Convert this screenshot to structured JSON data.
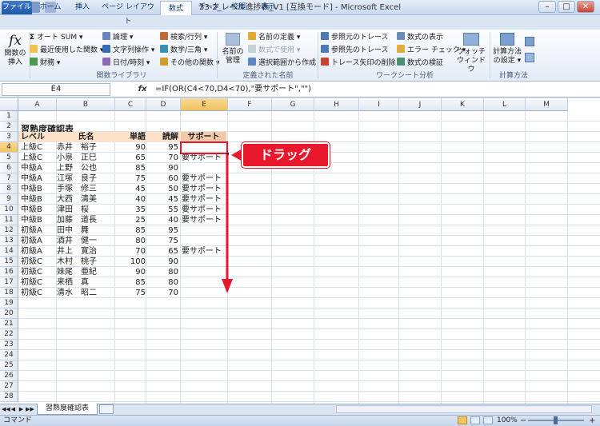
{
  "window": {
    "title": "33-2_レベル進捗表_V1  [互換モード]  -  Microsoft Excel",
    "minimize": "–",
    "maximize": "□",
    "close": "✕"
  },
  "tabs": [
    "ファイル",
    "ホーム",
    "挿入",
    "ページ レイアウト",
    "数式",
    "データ",
    "校閲",
    "表示"
  ],
  "active_tab": "数式",
  "ribbon": {
    "insert_function": [
      "関数の",
      "挿入"
    ],
    "library": {
      "autosum": "オート SUM ▾",
      "recent": "最近使用した関数 ▾",
      "financial": "財務 ▾",
      "logical": "論理 ▾",
      "text": "文字列操作 ▾",
      "datetime": "日付/時刻 ▾",
      "lookup": "検索/行列 ▾",
      "math": "数学/三角 ▾",
      "more": "その他の関数 ▾",
      "group_label": "関数ライブラリ"
    },
    "names": {
      "manager": [
        "名前の",
        "管理"
      ],
      "define": "名前の定義 ▾",
      "use": "数式で使用 ▾",
      "create": "選択範囲から作成",
      "group_label": "定義された名前"
    },
    "audit": {
      "precedents": "参照元のトレース",
      "dependents": "参照先のトレース",
      "remove_arrows": "トレース矢印の削除 ▾",
      "show_formulas": "数式の表示",
      "error_check": "エラー チェック ▾",
      "evaluate": "数式の検証",
      "group_label": "ワークシート分析"
    },
    "watch": [
      "ウォッチ",
      "ウィンドウ"
    ],
    "calc_options": [
      "計算方法",
      "の設定 ▾"
    ],
    "calc_group_label": "計算方法"
  },
  "formula_bar": {
    "name_box": "E4",
    "fx": "fx",
    "formula": "=IF(OR(C4<70,D4<70),\"要サポート\",\"\")"
  },
  "columns": [
    "A",
    "B",
    "C",
    "D",
    "E",
    "F",
    "G",
    "H",
    "I",
    "J",
    "K",
    "L",
    "M"
  ],
  "selected_column": "E",
  "row_numbers": [
    "1",
    "2",
    "3",
    "4",
    "5",
    "6",
    "7",
    "8",
    "9",
    "10",
    "11",
    "12",
    "13",
    "14",
    "15",
    "16",
    "17",
    "18",
    "19",
    "20",
    "21",
    "22",
    "23",
    "24",
    "25",
    "26",
    "27",
    "28"
  ],
  "selected_row": "4",
  "sheet": {
    "title": "習熟度確認表",
    "headers": [
      "レベル",
      "氏名",
      "単語",
      "読解",
      "サポート"
    ],
    "rows": [
      [
        "上級C",
        "赤井　裕子",
        "90",
        "95",
        ""
      ],
      [
        "上級C",
        "小泉　正巳",
        "65",
        "70",
        "要サポート"
      ],
      [
        "中級A",
        "上野　公也",
        "85",
        "90",
        ""
      ],
      [
        "中級A",
        "江塚　良子",
        "75",
        "60",
        "要サポート"
      ],
      [
        "中級B",
        "手塚　修三",
        "45",
        "50",
        "要サポート"
      ],
      [
        "中級B",
        "大西　清美",
        "40",
        "45",
        "要サポート"
      ],
      [
        "中級B",
        "津田　桜",
        "35",
        "55",
        "要サポート"
      ],
      [
        "中級B",
        "加藤　道長",
        "25",
        "40",
        "要サポート"
      ],
      [
        "初級A",
        "田中　舞",
        "85",
        "95",
        ""
      ],
      [
        "初級A",
        "酒井　健一",
        "80",
        "75",
        ""
      ],
      [
        "初級A",
        "井上　寛治",
        "70",
        "65",
        "要サポート"
      ],
      [
        "初級C",
        "木村　桃子",
        "100",
        "90",
        ""
      ],
      [
        "初級C",
        "妹尾　亜紀",
        "90",
        "80",
        ""
      ],
      [
        "初級C",
        "来栖　真",
        "85",
        "80",
        ""
      ],
      [
        "初級C",
        "清水　昭二",
        "75",
        "70",
        ""
      ]
    ]
  },
  "annotation": {
    "label": "ドラッグ",
    "accent": "#e8172b"
  },
  "sheet_tabs": {
    "nav": [
      "◀◀",
      "◀",
      "▶",
      "▶▶"
    ],
    "active": "習熟度確認表"
  },
  "status": {
    "mode": "コマンド",
    "zoom": "100%",
    "zoom_minus": "−",
    "zoom_plus": "+"
  }
}
